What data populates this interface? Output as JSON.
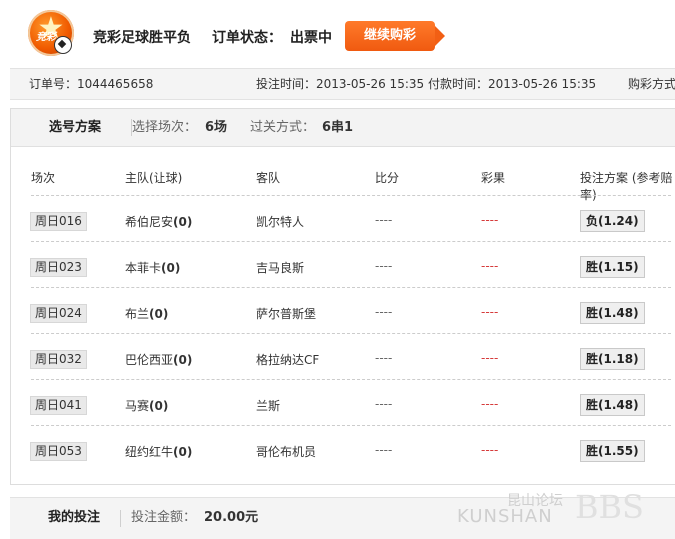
{
  "header": {
    "title": "竞彩足球胜平负",
    "status_label": "订单状态：",
    "status_value": "出票中",
    "continue_button": "继续购彩",
    "logo_text": "竞彩"
  },
  "order": {
    "id_label": "订单号：1044465658",
    "bet_time": "投注时间：2013-05-26 15:35",
    "pay_time": "付款时间：2013-05-26 15:35",
    "buy_mode": "购彩方式"
  },
  "selection": {
    "title": "选号方案",
    "matches_label": "选择场次：",
    "matches_value": "6场",
    "pass_label": "过关方式：",
    "pass_value": "6串1"
  },
  "table": {
    "headers": [
      "场次",
      "主队(让球)",
      "客队",
      "比分",
      "彩果",
      "投注方案 (参考赔率)"
    ],
    "rows": [
      {
        "date": "周日016",
        "home": "希伯尼安",
        "handicap": "(0)",
        "away": "凯尔特人",
        "score": "----",
        "result": "----",
        "plan": "负(1.24)"
      },
      {
        "date": "周日023",
        "home": "本菲卡",
        "handicap": "(0)",
        "away": "吉马良斯",
        "score": "----",
        "result": "----",
        "plan": "胜(1.15)"
      },
      {
        "date": "周日024",
        "home": "布兰",
        "handicap": "(0)",
        "away": "萨尔普斯堡",
        "score": "----",
        "result": "----",
        "plan": "胜(1.48)"
      },
      {
        "date": "周日032",
        "home": "巴伦西亚",
        "handicap": "(0)",
        "away": "格拉纳达CF",
        "score": "----",
        "result": "----",
        "plan": "胜(1.18)"
      },
      {
        "date": "周日041",
        "home": "马赛",
        "handicap": "(0)",
        "away": "兰斯",
        "score": "----",
        "result": "----",
        "plan": "胜(1.48)"
      },
      {
        "date": "周日053",
        "home": "纽约红牛",
        "handicap": "(0)",
        "away": "哥伦布机员",
        "score": "----",
        "result": "----",
        "plan": "胜(1.55)"
      }
    ]
  },
  "my_bet": {
    "title": "我的投注",
    "amount_label": "投注金额：",
    "amount_value": "20.00元"
  },
  "watermark": {
    "cn": "昆山论坛",
    "en": "KUNSHAN",
    "bbs": "BBS"
  }
}
